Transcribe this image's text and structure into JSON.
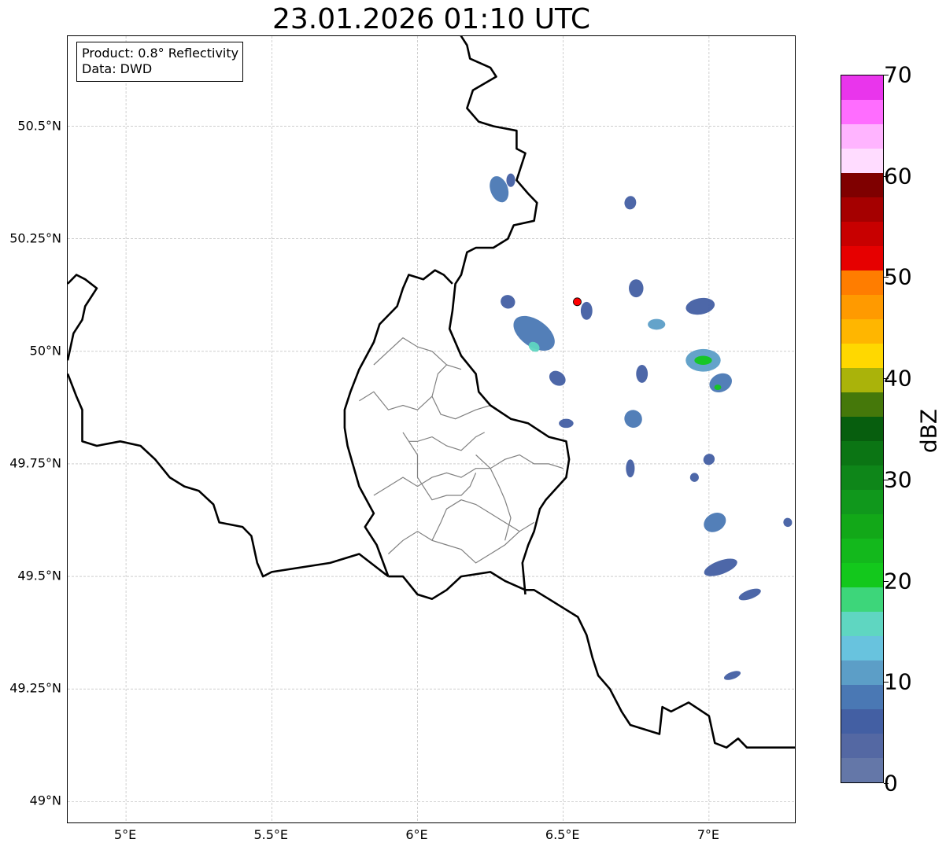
{
  "title": "23.01.2026 01:10 UTC",
  "info": {
    "product": "Product: 0.8° Reflectivity",
    "source": "Data: DWD"
  },
  "map": {
    "extent": {
      "lon_min": 4.8,
      "lon_max": 7.3,
      "lat_min": 48.95,
      "lat_max": 50.7
    },
    "lat_ticks": [
      {
        "value": 50.5,
        "label": "50.5°N"
      },
      {
        "value": 50.25,
        "label": "50.25°N"
      },
      {
        "value": 50.0,
        "label": "50°N"
      },
      {
        "value": 49.75,
        "label": "49.75°N"
      },
      {
        "value": 49.5,
        "label": "49.5°N"
      },
      {
        "value": 49.25,
        "label": "49.25°N"
      },
      {
        "value": 49.0,
        "label": "49°N"
      }
    ],
    "lon_ticks": [
      {
        "value": 5.0,
        "label": "5°E"
      },
      {
        "value": 5.5,
        "label": "5.5°E"
      },
      {
        "value": 6.0,
        "label": "6°E"
      },
      {
        "value": 6.5,
        "label": "6.5°E"
      },
      {
        "value": 7.0,
        "label": "7°E"
      }
    ],
    "radar_site": {
      "lon": 6.548,
      "lat": 50.11,
      "color": "#ff0000"
    },
    "border_color": "#000000",
    "admin_color": "#808080",
    "country_borders": [
      [
        [
          6.13,
          50.72
        ],
        [
          6.17,
          50.68
        ],
        [
          6.18,
          50.65
        ],
        [
          6.25,
          50.63
        ],
        [
          6.27,
          50.61
        ],
        [
          6.19,
          50.58
        ],
        [
          6.17,
          50.54
        ],
        [
          6.21,
          50.51
        ],
        [
          6.26,
          50.5
        ],
        [
          6.34,
          50.49
        ],
        [
          6.34,
          50.45
        ],
        [
          6.37,
          50.44
        ],
        [
          6.34,
          50.38
        ],
        [
          6.38,
          50.35
        ],
        [
          6.41,
          50.33
        ],
        [
          6.4,
          50.29
        ],
        [
          6.33,
          50.28
        ],
        [
          6.31,
          50.25
        ],
        [
          6.26,
          50.23
        ],
        [
          6.2,
          50.23
        ],
        [
          6.17,
          50.22
        ],
        [
          6.15,
          50.17
        ],
        [
          6.13,
          50.15
        ],
        [
          6.12,
          50.09
        ],
        [
          6.11,
          50.05
        ],
        [
          6.13,
          50.02
        ],
        [
          6.15,
          49.99
        ],
        [
          6.2,
          49.95
        ],
        [
          6.21,
          49.91
        ],
        [
          6.25,
          49.88
        ],
        [
          6.32,
          49.85
        ],
        [
          6.38,
          49.84
        ],
        [
          6.45,
          49.81
        ],
        [
          6.51,
          49.8
        ],
        [
          6.52,
          49.76
        ],
        [
          6.51,
          49.72
        ],
        [
          6.44,
          49.67
        ],
        [
          6.42,
          49.65
        ],
        [
          6.4,
          49.6
        ],
        [
          6.38,
          49.57
        ],
        [
          6.36,
          49.53
        ],
        [
          6.37,
          49.46
        ]
      ],
      [
        [
          5.9,
          49.5
        ],
        [
          5.86,
          49.57
        ],
        [
          5.82,
          49.61
        ],
        [
          5.85,
          49.64
        ],
        [
          5.8,
          49.7
        ],
        [
          5.76,
          49.79
        ],
        [
          5.75,
          49.83
        ],
        [
          5.75,
          49.87
        ],
        [
          5.77,
          49.91
        ],
        [
          5.8,
          49.96
        ],
        [
          5.85,
          50.02
        ],
        [
          5.87,
          50.06
        ],
        [
          5.93,
          50.1
        ],
        [
          5.95,
          50.14
        ],
        [
          5.97,
          50.17
        ],
        [
          6.02,
          50.16
        ],
        [
          6.06,
          50.18
        ],
        [
          6.09,
          50.17
        ],
        [
          6.12,
          50.15
        ]
      ],
      [
        [
          5.9,
          49.5
        ],
        [
          5.95,
          49.5
        ],
        [
          6.0,
          49.46
        ],
        [
          6.05,
          49.45
        ],
        [
          6.1,
          49.47
        ],
        [
          6.15,
          49.5
        ],
        [
          6.25,
          49.51
        ],
        [
          6.3,
          49.49
        ],
        [
          6.37,
          49.47
        ],
        [
          6.4,
          49.47
        ],
        [
          6.45,
          49.45
        ],
        [
          6.5,
          49.43
        ],
        [
          6.55,
          49.41
        ],
        [
          6.58,
          49.37
        ],
        [
          6.6,
          49.32
        ],
        [
          6.62,
          49.28
        ],
        [
          6.66,
          49.25
        ],
        [
          6.7,
          49.2
        ],
        [
          6.73,
          49.17
        ],
        [
          6.78,
          49.16
        ],
        [
          6.83,
          49.15
        ],
        [
          6.84,
          49.21
        ],
        [
          6.87,
          49.2
        ],
        [
          6.93,
          49.22
        ],
        [
          7.0,
          49.19
        ],
        [
          7.02,
          49.13
        ],
        [
          7.06,
          49.12
        ],
        [
          7.1,
          49.14
        ],
        [
          7.13,
          49.12
        ],
        [
          7.2,
          49.12
        ],
        [
          7.25,
          49.12
        ],
        [
          7.3,
          49.12
        ]
      ],
      [
        [
          5.9,
          49.5
        ],
        [
          5.8,
          49.55
        ],
        [
          5.7,
          49.53
        ],
        [
          5.6,
          49.52
        ],
        [
          5.5,
          49.51
        ],
        [
          5.47,
          49.5
        ],
        [
          5.45,
          49.53
        ],
        [
          5.43,
          49.59
        ],
        [
          5.4,
          49.61
        ],
        [
          5.32,
          49.62
        ],
        [
          5.3,
          49.66
        ],
        [
          5.25,
          49.69
        ],
        [
          5.2,
          49.7
        ],
        [
          5.15,
          49.72
        ],
        [
          5.1,
          49.76
        ],
        [
          5.05,
          49.79
        ],
        [
          4.98,
          49.8
        ],
        [
          4.9,
          49.79
        ],
        [
          4.85,
          49.8
        ],
        [
          4.85,
          49.87
        ],
        [
          4.83,
          49.9
        ],
        [
          4.8,
          49.95
        ]
      ],
      [
        [
          4.8,
          50.15
        ],
        [
          4.83,
          50.17
        ],
        [
          4.86,
          50.16
        ],
        [
          4.9,
          50.14
        ],
        [
          4.86,
          50.1
        ],
        [
          4.85,
          50.07
        ],
        [
          4.82,
          50.04
        ],
        [
          4.8,
          49.98
        ]
      ]
    ],
    "admin_borders": [
      [
        [
          5.85,
          49.97
        ],
        [
          5.9,
          50.0
        ],
        [
          5.95,
          50.03
        ],
        [
          6.0,
          50.01
        ],
        [
          6.05,
          50.0
        ],
        [
          6.1,
          49.97
        ],
        [
          6.15,
          49.96
        ]
      ],
      [
        [
          5.8,
          49.89
        ],
        [
          5.85,
          49.91
        ],
        [
          5.9,
          49.87
        ],
        [
          5.95,
          49.88
        ],
        [
          6.0,
          49.87
        ],
        [
          6.05,
          49.9
        ],
        [
          6.07,
          49.95
        ],
        [
          6.1,
          49.97
        ]
      ],
      [
        [
          6.05,
          49.9
        ],
        [
          6.08,
          49.86
        ],
        [
          6.13,
          49.85
        ],
        [
          6.2,
          49.87
        ],
        [
          6.25,
          49.88
        ]
      ],
      [
        [
          5.97,
          49.8
        ],
        [
          6.0,
          49.8
        ],
        [
          6.05,
          49.81
        ],
        [
          6.1,
          49.79
        ],
        [
          6.15,
          49.78
        ],
        [
          6.2,
          49.81
        ],
        [
          6.23,
          49.82
        ]
      ],
      [
        [
          5.85,
          49.68
        ],
        [
          5.9,
          49.7
        ],
        [
          5.95,
          49.72
        ],
        [
          6.0,
          49.7
        ],
        [
          6.05,
          49.72
        ],
        [
          6.1,
          49.73
        ],
        [
          6.15,
          49.72
        ],
        [
          6.2,
          49.74
        ],
        [
          6.25,
          49.74
        ],
        [
          6.3,
          49.76
        ],
        [
          6.35,
          49.77
        ],
        [
          6.4,
          49.75
        ],
        [
          6.45,
          49.75
        ],
        [
          6.5,
          49.74
        ]
      ],
      [
        [
          5.95,
          49.82
        ],
        [
          5.97,
          49.8
        ],
        [
          6.0,
          49.77
        ],
        [
          6.0,
          49.72
        ],
        [
          6.03,
          49.69
        ],
        [
          6.05,
          49.67
        ],
        [
          6.1,
          49.68
        ],
        [
          6.15,
          49.68
        ],
        [
          6.18,
          49.7
        ],
        [
          6.2,
          49.73
        ]
      ],
      [
        [
          5.9,
          49.55
        ],
        [
          5.95,
          49.58
        ],
        [
          6.0,
          49.6
        ],
        [
          6.05,
          49.58
        ],
        [
          6.1,
          49.57
        ],
        [
          6.15,
          49.56
        ],
        [
          6.2,
          49.53
        ],
        [
          6.25,
          49.55
        ],
        [
          6.3,
          49.57
        ],
        [
          6.35,
          49.6
        ],
        [
          6.4,
          49.62
        ]
      ],
      [
        [
          6.05,
          49.58
        ],
        [
          6.08,
          49.62
        ],
        [
          6.1,
          49.65
        ],
        [
          6.15,
          49.67
        ],
        [
          6.2,
          49.66
        ],
        [
          6.25,
          49.64
        ],
        [
          6.3,
          49.62
        ],
        [
          6.35,
          49.6
        ]
      ],
      [
        [
          6.2,
          49.77
        ],
        [
          6.25,
          49.74
        ],
        [
          6.28,
          49.7
        ],
        [
          6.3,
          49.67
        ],
        [
          6.32,
          49.63
        ],
        [
          6.3,
          49.58
        ]
      ]
    ],
    "echo_cells": [
      {
        "lon": 6.28,
        "lat": 50.36,
        "rx": 0.03,
        "ry": 0.03,
        "rot": -20,
        "dbz": 8
      },
      {
        "lon": 6.32,
        "lat": 50.38,
        "rx": 0.015,
        "ry": 0.015,
        "rot": 0,
        "dbz": 6
      },
      {
        "lon": 6.4,
        "lat": 50.04,
        "rx": 0.08,
        "ry": 0.03,
        "rot": 35,
        "dbz": 9
      },
      {
        "lon": 6.31,
        "lat": 50.11,
        "rx": 0.025,
        "ry": 0.015,
        "rot": 20,
        "dbz": 7
      },
      {
        "lon": 6.4,
        "lat": 50.01,
        "rx": 0.02,
        "ry": 0.01,
        "rot": 35,
        "dbz": 16
      },
      {
        "lon": 6.48,
        "lat": 49.94,
        "rx": 0.03,
        "ry": 0.015,
        "rot": 35,
        "dbz": 7
      },
      {
        "lon": 6.51,
        "lat": 49.84,
        "rx": 0.025,
        "ry": 0.01,
        "rot": 0,
        "dbz": 7
      },
      {
        "lon": 6.58,
        "lat": 50.09,
        "rx": 0.02,
        "ry": 0.02,
        "rot": 0,
        "dbz": 7
      },
      {
        "lon": 6.73,
        "lat": 50.33,
        "rx": 0.02,
        "ry": 0.015,
        "rot": 10,
        "dbz": 6
      },
      {
        "lon": 6.75,
        "lat": 50.14,
        "rx": 0.025,
        "ry": 0.02,
        "rot": 0,
        "dbz": 7
      },
      {
        "lon": 6.82,
        "lat": 50.06,
        "rx": 0.03,
        "ry": 0.012,
        "rot": 0,
        "dbz": 10
      },
      {
        "lon": 6.77,
        "lat": 49.95,
        "rx": 0.02,
        "ry": 0.02,
        "rot": 0,
        "dbz": 7
      },
      {
        "lon": 6.74,
        "lat": 49.85,
        "rx": 0.03,
        "ry": 0.02,
        "rot": -40,
        "dbz": 8
      },
      {
        "lon": 6.73,
        "lat": 49.74,
        "rx": 0.015,
        "ry": 0.02,
        "rot": 0,
        "dbz": 7
      },
      {
        "lon": 6.97,
        "lat": 50.1,
        "rx": 0.05,
        "ry": 0.018,
        "rot": -10,
        "dbz": 7
      },
      {
        "lon": 6.98,
        "lat": 49.98,
        "rx": 0.06,
        "ry": 0.025,
        "rot": 0,
        "dbz": 12
      },
      {
        "lon": 6.98,
        "lat": 49.98,
        "rx": 0.03,
        "ry": 0.01,
        "rot": 0,
        "dbz": 22
      },
      {
        "lon": 7.04,
        "lat": 49.93,
        "rx": 0.04,
        "ry": 0.02,
        "rot": -25,
        "dbz": 9
      },
      {
        "lon": 7.03,
        "lat": 49.92,
        "rx": 0.012,
        "ry": 0.006,
        "rot": 0,
        "dbz": 20
      },
      {
        "lon": 7.0,
        "lat": 49.76,
        "rx": 0.02,
        "ry": 0.012,
        "rot": -40,
        "dbz": 7
      },
      {
        "lon": 6.95,
        "lat": 49.72,
        "rx": 0.015,
        "ry": 0.01,
        "rot": 0,
        "dbz": 6
      },
      {
        "lon": 7.02,
        "lat": 49.62,
        "rx": 0.04,
        "ry": 0.02,
        "rot": -30,
        "dbz": 9
      },
      {
        "lon": 7.04,
        "lat": 49.52,
        "rx": 0.06,
        "ry": 0.015,
        "rot": -20,
        "dbz": 7
      },
      {
        "lon": 7.14,
        "lat": 49.46,
        "rx": 0.04,
        "ry": 0.01,
        "rot": -20,
        "dbz": 6
      },
      {
        "lon": 7.08,
        "lat": 49.28,
        "rx": 0.03,
        "ry": 0.008,
        "rot": -20,
        "dbz": 6
      },
      {
        "lon": 7.27,
        "lat": 49.62,
        "rx": 0.015,
        "ry": 0.01,
        "rot": -30,
        "dbz": 6
      }
    ]
  },
  "colorbar": {
    "label": "dBZ",
    "ticks": [
      0,
      10,
      20,
      30,
      40,
      50,
      60,
      70
    ],
    "min": 0,
    "max": 70,
    "step": 2.5,
    "colors": [
      "#6477a8",
      "#5468a3",
      "#435fa3",
      "#4a78b4",
      "#5c9ec7",
      "#68c3de",
      "#5fd6c1",
      "#3dd67a",
      "#13c81c",
      "#13b81c",
      "#12a818",
      "#10981c",
      "#0e8619",
      "#0b7514",
      "#075e0e",
      "#45780a",
      "#aab30a",
      "#ffd800",
      "#ffb600",
      "#ff9a00",
      "#ff7d00",
      "#e60000",
      "#c80000",
      "#a50000",
      "#7f0000",
      "#ffdcff",
      "#ffb4ff",
      "#ff6dff",
      "#e935ec"
    ]
  }
}
